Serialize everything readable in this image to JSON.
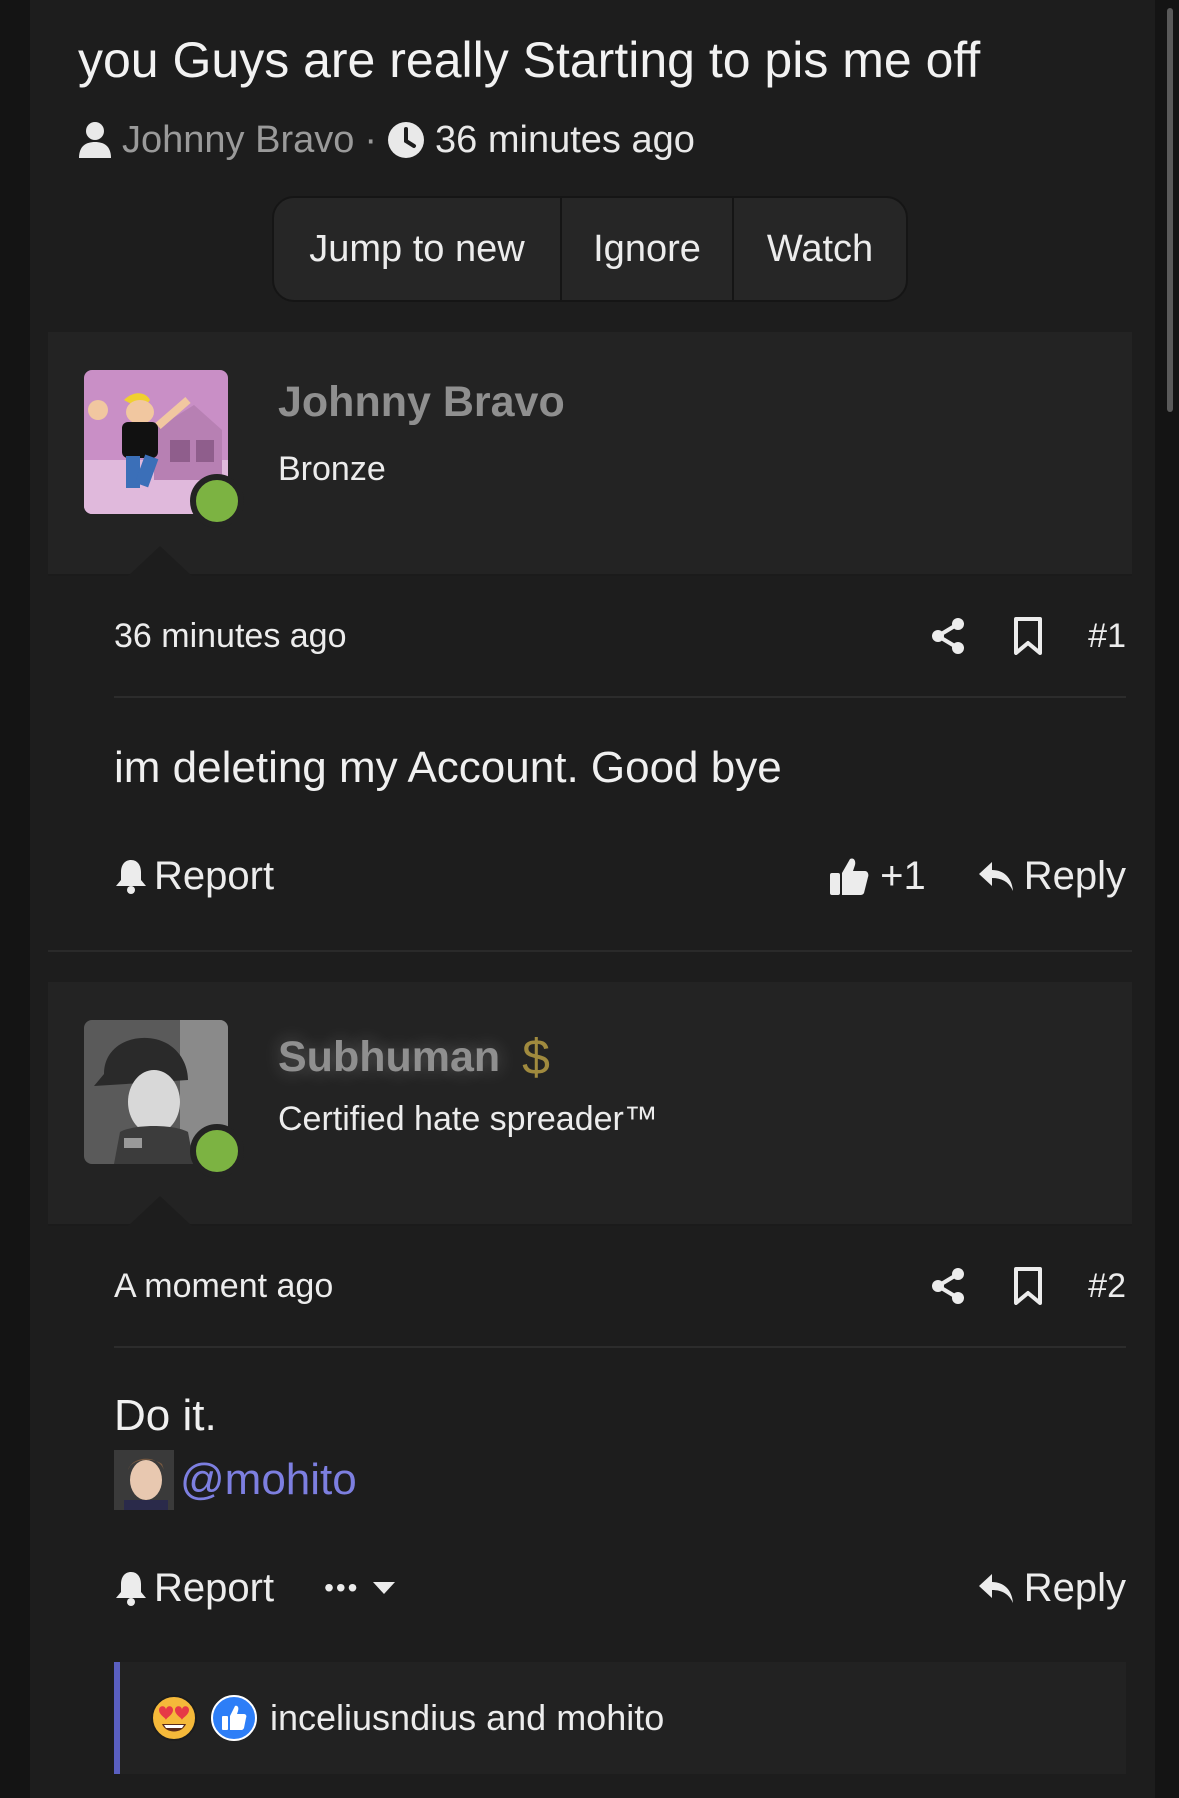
{
  "thread": {
    "title": "you Guys are really Starting to pis me off",
    "author": "Johnny Bravo",
    "separator": "·",
    "time": "36 minutes ago",
    "buttons": [
      "Jump to new",
      "Ignore",
      "Watch"
    ]
  },
  "posts": [
    {
      "username": "Johnny Bravo",
      "user_title": "Bronze",
      "time": "36 minutes ago",
      "number": "#1",
      "body": "im deleting my Account. Good bye",
      "report_label": "Report",
      "like_count": "+1",
      "reply_label": "Reply"
    },
    {
      "username": "Subhuman",
      "badge_symbol": "$",
      "user_title": "Certified hate spreader™",
      "time": "A moment ago",
      "number": "#2",
      "body": "Do it.",
      "mention": "@mohito",
      "report_label": "Report",
      "more_label": "•••",
      "reply_label": "Reply"
    }
  ],
  "reactions": {
    "text": "inceliusndius and mohito",
    "icons": [
      "heart-eyes-icon",
      "thumbs-up-icon"
    ]
  },
  "colors": {
    "background": "#1d1d1d",
    "post_header": "#232323",
    "online": "#7cb342",
    "mention": "#7d7fe0",
    "reaction_bar": "#5a5fc0"
  }
}
